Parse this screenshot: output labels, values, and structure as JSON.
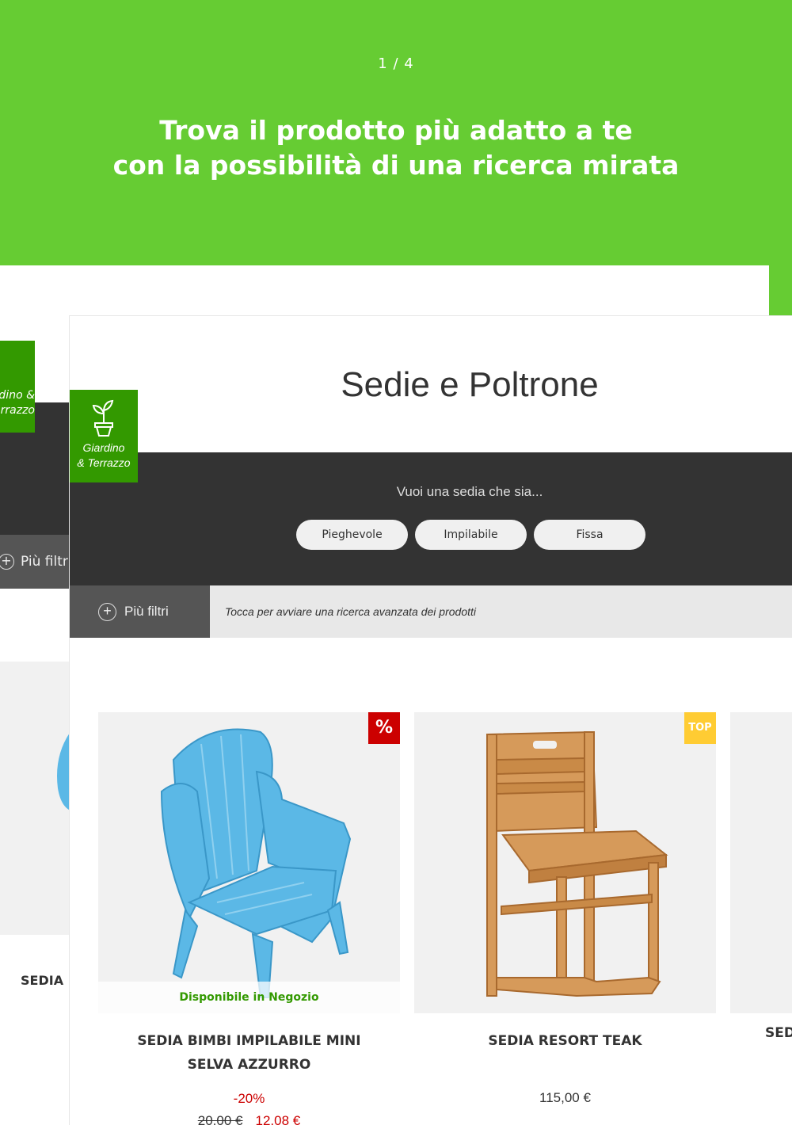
{
  "header": {
    "counter": "1 / 4",
    "headline_line1": "Trova il prodotto più adatto a te",
    "headline_line2": "con la possibilità di una ricerca mirata"
  },
  "back_screen": {
    "category_label": "Giardino & Terrazzo",
    "more_filters": "Più filtri",
    "product_name_partial": "SEDIA B"
  },
  "screen": {
    "title": "Sedie e Poltrone",
    "category_badge": {
      "line1": "Giardino",
      "line2": "& Terrazzo",
      "icon": "plant-pot-icon"
    },
    "question": "Vuoi una sedia che sia...",
    "options": [
      "Pieghevole",
      "Impilabile",
      "Fissa"
    ],
    "filter": {
      "button": "Più filtri",
      "hint": "Tocca per avviare una ricerca avanzata dei prodotti"
    },
    "products": [
      {
        "name": "SEDIA BIMBI IMPILABILE MINI SELVA AZZURRO",
        "badge": "%",
        "availability": "Disponibile in Negozio",
        "discount": "-20%",
        "old_price": "20,00 €",
        "price": "12,08 €"
      },
      {
        "name": "SEDIA RESORT TEAK",
        "badge": "TOP",
        "price": "115,00 €"
      },
      {
        "name": "SED"
      }
    ]
  },
  "colors": {
    "brand_green": "#66cc33",
    "category_green": "#339900",
    "dark_band": "#333333",
    "sale_red": "#cc0000",
    "top_yellow": "#ffcc33"
  }
}
